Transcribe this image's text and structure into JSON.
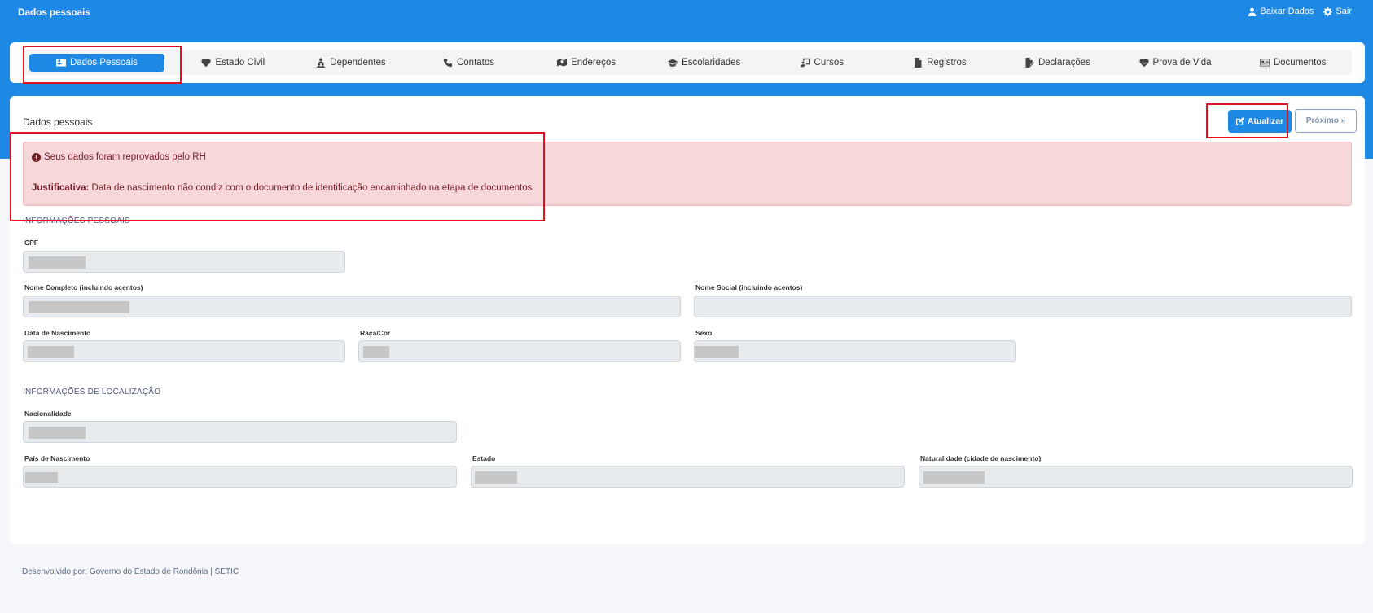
{
  "header": {
    "title": "Dados pessoais",
    "actions": [
      {
        "label": "Baixar Dados",
        "icon": "user-icon"
      },
      {
        "label": "Sair",
        "icon": "gear-icon"
      }
    ]
  },
  "tabs": [
    {
      "label": "Dados Pessoais",
      "icon": "id-card-icon",
      "active": true
    },
    {
      "label": "Estado Civil",
      "icon": "heart-icon"
    },
    {
      "label": "Dependentes",
      "icon": "people-icon"
    },
    {
      "label": "Contatos",
      "icon": "phone-icon"
    },
    {
      "label": "Endereços",
      "icon": "map-icon"
    },
    {
      "label": "Escolaridades",
      "icon": "graduation-cap-icon"
    },
    {
      "label": "Cursos",
      "icon": "teacher-icon"
    },
    {
      "label": "Registros",
      "icon": "file-icon"
    },
    {
      "label": "Declarações",
      "icon": "file-signature-icon"
    },
    {
      "label": "Prova de Vida",
      "icon": "heartbeat-icon"
    },
    {
      "label": "Documentos",
      "icon": "address-card-icon"
    }
  ],
  "main": {
    "title": "Dados pessoais",
    "update_label": "Atualizar",
    "next_label": "Próximo »",
    "alert": {
      "message": "Seus dados foram reprovados pelo RH",
      "justification_label": "Justificativa:",
      "justification_text": "Data de nascimento não condiz com o documento de identificação encaminhado na etapa de documentos"
    },
    "personal_section": "INFORMAÇÕES PESSOAIS",
    "location_section": "INFORMAÇÕES DE LOCALIZAÇÃO",
    "fields": {
      "cpf": "CPF",
      "full_name": "Nome Completo (incluindo acentos)",
      "social_name": "Nome Social (incluindo acentos)",
      "birth_date": "Data de Nascimento",
      "race": "Raça/Cor",
      "sex": "Sexo",
      "nationality": "Nacionalidade",
      "birth_country": "País de Nascimento",
      "state": "Estado",
      "birthplace": "Naturalidade (cidade de nascimento)"
    }
  },
  "footer": {
    "text": "Desenvolvido por: Governo do Estado de Rondônia | SETIC"
  },
  "colors": {
    "primary": "#1e88e5",
    "alert_bg": "#f8d7da",
    "alert_text": "#721c24",
    "highlight": "#e0101e"
  }
}
